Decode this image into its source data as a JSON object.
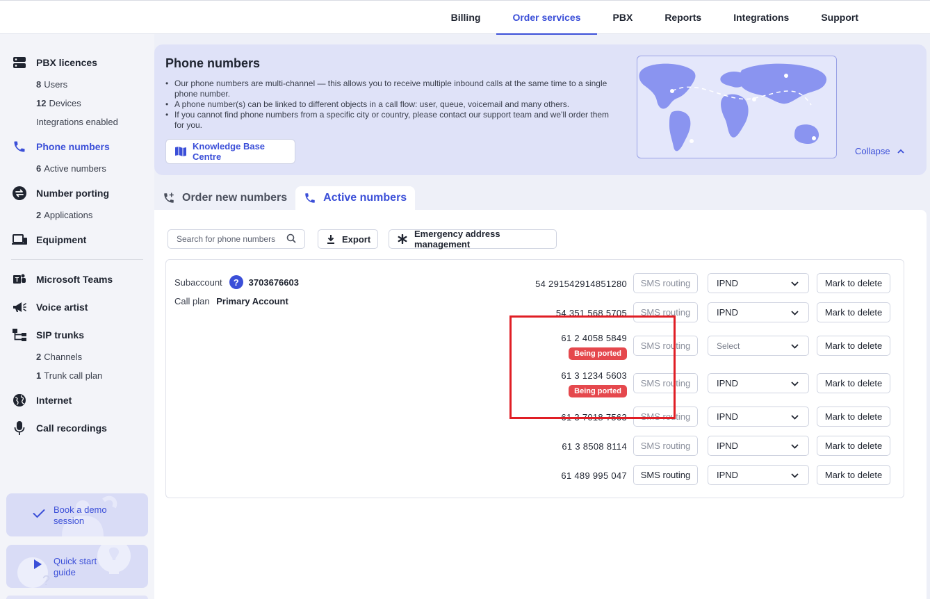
{
  "topnav": {
    "items": [
      "Billing",
      "Order services",
      "PBX",
      "Reports",
      "Integrations",
      "Support"
    ],
    "active_index": 1
  },
  "sidebar": {
    "pbx_licences": {
      "label": "PBX licences",
      "subs": [
        {
          "count": "8",
          "text": "Users"
        },
        {
          "count": "12",
          "text": "Devices"
        },
        {
          "count": "",
          "text": "Integrations enabled"
        }
      ]
    },
    "phone_numbers": {
      "label": "Phone numbers",
      "subs": [
        {
          "count": "6",
          "text": "Active numbers"
        }
      ]
    },
    "number_porting": {
      "label": "Number porting",
      "subs": [
        {
          "count": "2",
          "text": "Applications"
        }
      ]
    },
    "equipment": {
      "label": "Equipment"
    },
    "microsoft_teams": {
      "label": "Microsoft Teams"
    },
    "voice_artist": {
      "label": "Voice artist"
    },
    "sip_trunks": {
      "label": "SIP trunks",
      "subs": [
        {
          "count": "2",
          "text": "Channels"
        },
        {
          "count": "1",
          "text": "Trunk call plan"
        }
      ]
    },
    "internet": {
      "label": "Internet"
    },
    "call_recordings": {
      "label": "Call recordings"
    },
    "promo_demo": "Book a demo session",
    "promo_demo_l1": "Book a demo",
    "promo_demo_l2": "session",
    "promo_guide_l1": "Quick start",
    "promo_guide_l2": "guide"
  },
  "banner": {
    "title": "Phone numbers",
    "bullets": [
      "Our phone numbers are multi-channel — this allows you to receive multiple inbound calls at the same time to a single phone number.",
      "A phone number(s) can be linked to different objects in a call flow: user, queue, voicemail and many others.",
      "If you cannot find phone numbers from a specific city or country, please contact our support team and we'll order them for you."
    ],
    "kb_button": "Knowledge Base Centre",
    "collapse": "Collapse"
  },
  "tabs": {
    "order_new": "Order new numbers",
    "active": "Active numbers"
  },
  "toolbar": {
    "search_placeholder": "Search for phone numbers",
    "export": "Export",
    "emergency": "Emergency address management"
  },
  "account": {
    "subaccount_label": "Subaccount",
    "subaccount_value": "3703676603",
    "callplan_label": "Call plan",
    "callplan_value": "Primary Account"
  },
  "numbers": [
    {
      "number": "54 291542914851280",
      "badge": "",
      "sms": "SMS routing",
      "sms_on": false,
      "select": "IPND",
      "delete": "Mark to delete"
    },
    {
      "number": "54 351 568 5705",
      "badge": "",
      "sms": "SMS routing",
      "sms_on": false,
      "select": "IPND",
      "delete": "Mark to delete"
    },
    {
      "number": "61 2 4058 5849",
      "badge": "Being ported",
      "sms": "SMS routing",
      "sms_on": false,
      "select": "Select",
      "delete": "Mark to delete"
    },
    {
      "number": "61 3 1234 5603",
      "badge": "Being ported",
      "sms": "SMS routing",
      "sms_on": false,
      "select": "IPND",
      "delete": "Mark to delete"
    },
    {
      "number": "61 3 7018 7563",
      "badge": "",
      "sms": "SMS routing",
      "sms_on": false,
      "select": "IPND",
      "delete": "Mark to delete"
    },
    {
      "number": "61 3 8508 8114",
      "badge": "",
      "sms": "SMS routing",
      "sms_on": false,
      "select": "IPND",
      "delete": "Mark to delete"
    },
    {
      "number": "61 489 995 047",
      "badge": "",
      "sms": "SMS routing",
      "sms_on": true,
      "select": "IPND",
      "delete": "Mark to delete"
    }
  ],
  "colors": {
    "accent": "#3b4fd8",
    "badge": "#e5484d",
    "highlight_box": "#e01e25"
  }
}
